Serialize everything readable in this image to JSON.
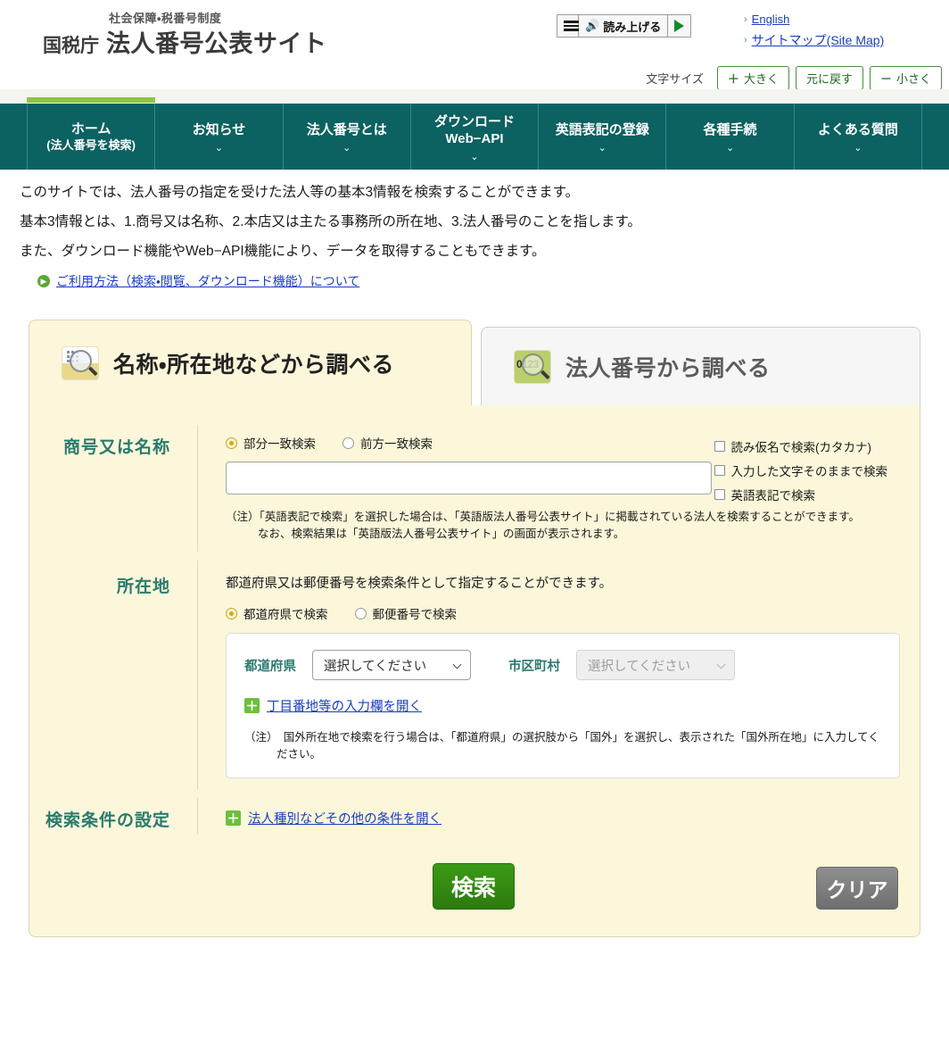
{
  "header": {
    "logo_sub": "社会保障・税番号制度",
    "logo_agency": "国税庁",
    "logo_main": "法人番号公表サイト",
    "speech": {
      "menu_icon": "hamburger-icon",
      "speaker_icon": "speaker-icon",
      "label": "読み上げる",
      "play_icon": "play-icon"
    },
    "links": [
      {
        "label": "English"
      },
      {
        "label": "サイトマップ(Site Map)"
      }
    ],
    "fontsize": {
      "label": "文字サイズ",
      "buttons": [
        {
          "sign": "＋",
          "label": "大きく"
        },
        {
          "sign": "",
          "label": "元に戻す"
        },
        {
          "sign": "－",
          "label": "小さく"
        }
      ]
    }
  },
  "nav": {
    "items": [
      {
        "line1": "ホーム",
        "line2": "(法人番号を検索)",
        "caret": false,
        "active": true
      },
      {
        "line1": "お知らせ",
        "line2": "",
        "caret": true,
        "active": false
      },
      {
        "line1": "法人番号とは",
        "line2": "",
        "caret": true,
        "active": false
      },
      {
        "line1": "ダウンロード",
        "line2": "Web−API",
        "caret": true,
        "active": false
      },
      {
        "line1": "英語表記の登録",
        "line2": "",
        "caret": true,
        "active": false
      },
      {
        "line1": "各種手続",
        "line2": "",
        "caret": true,
        "active": false
      },
      {
        "line1": "よくある質問",
        "line2": "",
        "caret": true,
        "active": false
      }
    ]
  },
  "intro": {
    "lines": [
      "このサイトでは、法人番号の指定を受けた法人等の基本3情報を検索することができます。",
      "基本3情報とは、1.商号又は名称、2.本店又は主たる事務所の所在地、3.法人番号のことを指します。",
      "また、ダウンロード機能やWeb−API機能により、データを取得することもできます。"
    ],
    "link": "ご利用方法（検索・閲覧、ダウンロード機能）について"
  },
  "tabs": [
    {
      "label": "名称・所在地などから調べる",
      "icon": "search-building-icon",
      "active": true
    },
    {
      "label": "法人番号から調べる",
      "icon": "search-number-icon",
      "active": false
    }
  ],
  "form": {
    "name_section": {
      "label": "商号又は名称",
      "radios": [
        {
          "label": "部分一致検索",
          "checked": true
        },
        {
          "label": "前方一致検索",
          "checked": false
        }
      ],
      "input_value": "",
      "input_placeholder": "",
      "checkboxes": [
        {
          "label": "読み仮名で検索(カタカナ)",
          "checked": false
        },
        {
          "label": "入力した文字そのままで検索",
          "checked": false
        },
        {
          "label": "英語表記で検索",
          "checked": false
        }
      ],
      "note_line1": "（注）「英語表記で検索」を選択した場合は、「英語版法人番号公表サイト」に掲載されている法人を検索することができます。",
      "note_line2": "なお、検索結果は「英語版法人番号公表サイト」の画面が表示されます。"
    },
    "location_section": {
      "label": "所在地",
      "lead": "都道府県又は郵便番号を検索条件として指定することができます。",
      "radios": [
        {
          "label": "都道府県で検索",
          "checked": true
        },
        {
          "label": "郵便番号で検索",
          "checked": false
        }
      ],
      "pref_label": "都道府県",
      "pref_value": "選択してください",
      "city_label": "市区町村",
      "city_value": "選択してください",
      "city_disabled": true,
      "expand_link": "丁目番地等の入力欄を開く",
      "note_line1": "（注）　国外所在地で検索を行う場合は、「都道府県」の選択肢から「国外」を選択し、表示された「国外所在地」に入力してく",
      "note_line2": "ださい。"
    },
    "conditions_section": {
      "label": "検索条件の設定",
      "expand_link": "法人種別などその他の条件を開く"
    },
    "buttons": {
      "search": "検索",
      "clear": "クリア"
    }
  },
  "colors": {
    "nav_bg": "#0c6161",
    "active_accent": "#8cc63e",
    "panel_bg": "#fcf7da",
    "label_teal": "#2a7a6e",
    "link_blue": "#1a3fbf",
    "search_green": "#2d7a0f",
    "clear_gray": "#6e6e6e"
  }
}
